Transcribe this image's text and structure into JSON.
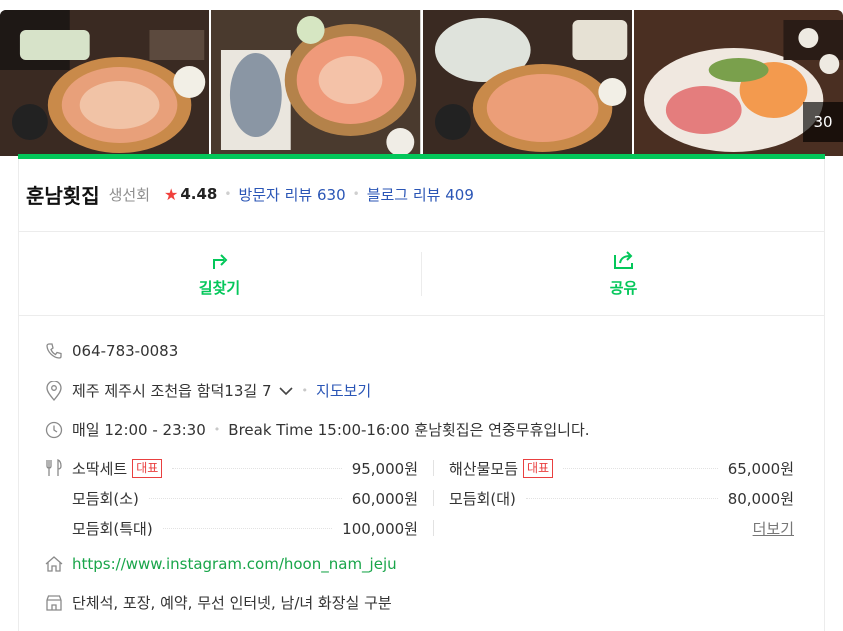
{
  "photos": {
    "count_label": "30"
  },
  "place": {
    "name": "훈남횟집",
    "category": "생선회",
    "rating": "4.48",
    "visitor_reviews": "방문자 리뷰 630",
    "blog_reviews": "블로그 리뷰 409"
  },
  "actions": {
    "directions": "길찾기",
    "share": "공유"
  },
  "info": {
    "phone": "064-783-0083",
    "address": "제주 제주시 조천읍 함덕13길 7",
    "map_link": "지도보기",
    "hours": "매일 12:00 - 23:30",
    "break_time": "Break Time 15:00-16:00 훈남횟집은 연중무휴입니다.",
    "website": "https://www.instagram.com/hoon_nam_jeju",
    "facilities": "단체석, 포장, 예약, 무선 인터넷, 남/녀 화장실 구분"
  },
  "menu": {
    "badge_label": "대표",
    "items": [
      {
        "name": "소딱세트",
        "price": "95,000원"
      },
      {
        "name": "해산물모듬",
        "price": "65,000원"
      },
      {
        "name": "모듬회(소)",
        "price": "60,000원"
      },
      {
        "name": "모듬회(대)",
        "price": "80,000원"
      },
      {
        "name": "모듬회(특대)",
        "price": "100,000원"
      }
    ],
    "more": "더보기"
  },
  "colors": {
    "accent": "#03c75a",
    "link": "#2b56b6",
    "star": "#f0403c",
    "badge": "#e94040"
  }
}
